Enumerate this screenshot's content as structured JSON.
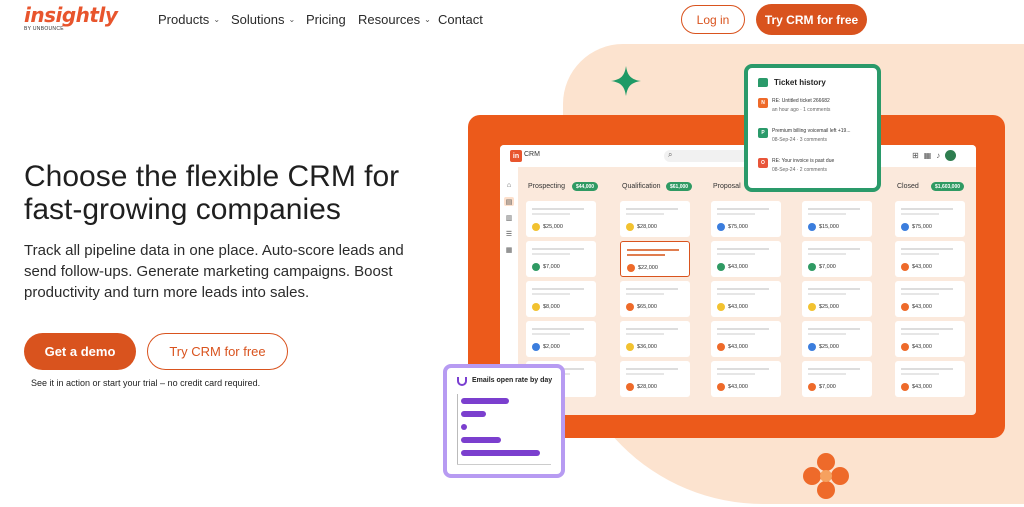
{
  "logo": {
    "word": "insightly",
    "sub": "BY UNBOUNCE"
  },
  "nav": {
    "products": "Products",
    "solutions": "Solutions",
    "pricing": "Pricing",
    "resources": "Resources",
    "contact": "Contact",
    "chevron": "⌄",
    "login": "Log in",
    "try": "Try CRM for free"
  },
  "hero": {
    "title": "Choose the flexible CRM for fast-growing companies",
    "subtitle": "Track all pipeline data in one place. Auto-score leads and send follow-ups. Generate marketing campaigns. Boost productivity and turn more leads into sales.",
    "demo_button": "Get a demo",
    "try_button": "Try CRM for free",
    "fine_print": "See it in action or start your trial – no credit card required."
  },
  "app": {
    "brand_badge": "in",
    "brand_name": "CRM",
    "columns": [
      {
        "title": "Prospecting",
        "badge": "$44,000",
        "amounts": [
          "$25,000",
          "$7,000",
          "$8,000",
          "$2,000",
          ""
        ]
      },
      {
        "title": "Qualification",
        "badge": "$61,000",
        "amounts": [
          "$28,000",
          "$22,000",
          "$65,000",
          "$36,000",
          "$28,000"
        ]
      },
      {
        "title": "Proposal",
        "badge": "",
        "amounts": [
          "$75,000",
          "$43,000",
          "$43,000",
          "$43,000",
          "$43,000"
        ]
      },
      {
        "title": "",
        "badge": "",
        "amounts": [
          "$15,000",
          "$7,000",
          "$25,000",
          "$25,000",
          "$7,000"
        ]
      },
      {
        "title": "Closed",
        "badge": "$1,603,000",
        "amounts": [
          "$75,000",
          "$43,000",
          "$43,000",
          "$43,000",
          "$43,000"
        ]
      }
    ]
  },
  "ticket": {
    "title": "Ticket history",
    "items": [
      {
        "badge": "N",
        "line1": "RE: Untitled ticket 266682",
        "line2": "an hour ago · 1 comments"
      },
      {
        "badge": "P",
        "line1": "Premium billing voicemail left +19...",
        "line2": "08-Sep-24 · 3 comments"
      },
      {
        "badge": "O",
        "line1": "RE: Your invoice is past due",
        "line2": "08-Sep-24 · 2 comments"
      }
    ]
  },
  "email_chart": {
    "title": "Emails open rate by day",
    "values": [
      0.55,
      0.28,
      0.07,
      0.45,
      0.9
    ]
  },
  "colors": {
    "brand": "#d9531e",
    "accent_green": "#2a9a6a",
    "accent_purple": "#7b3fce"
  }
}
